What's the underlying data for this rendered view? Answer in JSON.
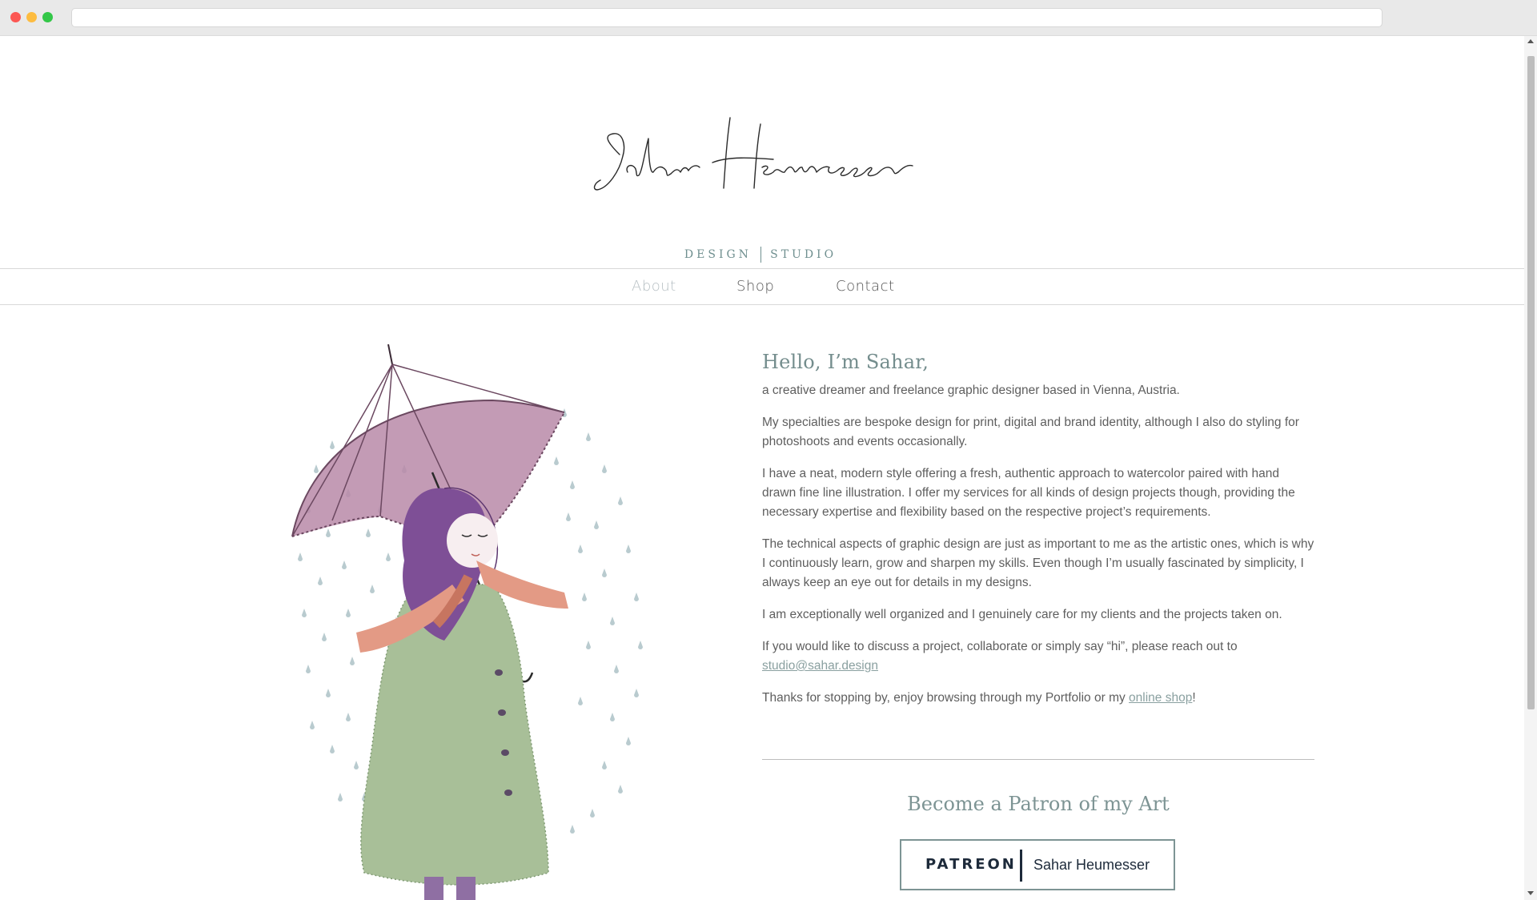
{
  "browser": {
    "url": ""
  },
  "logo": {
    "script_name": "Sahar Heumesser",
    "subtitle_left": "DESIGN",
    "subtitle_right": "STUDIO"
  },
  "nav": {
    "items": [
      {
        "label": "About",
        "active": true
      },
      {
        "label": "Shop",
        "active": false
      },
      {
        "label": "Contact",
        "active": false
      }
    ]
  },
  "about": {
    "greeting": "Hello, I’m Sahar,",
    "intro": "a creative dreamer and freelance graphic designer based in Vienna, Austria.",
    "p1": "My specialties are bespoke design for print, digital and brand identity, although I also do styling for photoshoots and events occasionally.",
    "p2": "I have a neat, modern style offering a fresh, authentic approach to watercolor paired with hand drawn fine line illustration. I offer my services for all kinds of design projects though, providing the necessary expertise and flexibility based on the respective project’s requirements.",
    "p3": "The technical aspects of graphic design are just as important to me as the artistic ones, which is why I continuously learn, grow and sharpen my skills. Even though I’m usually fascinated by simplicity, I always keep an eye out for details in my designs.",
    "p4": "I am exceptionally well organized and I genuinely care for my clients and the projects taken on.",
    "p5_text": "If you would like to discuss a project, collaborate or simply say “hi”, please reach out to",
    "email": "studio@sahar.design",
    "p6_text": "Thanks for stopping by, enjoy browsing through my Portfolio or my",
    "shop_link": "online shop",
    "p6_end": "!"
  },
  "patron": {
    "title": "Become a Patron of my Art",
    "brand": "PATREON",
    "name": "Sahar Heumesser"
  },
  "colors": {
    "accent": "#748d8d",
    "text": "#5e5e5e",
    "nav_active": "#b5bec2",
    "umbrella": "#b98aa8",
    "coat": "#a8bf98",
    "hair": "#7e4f96",
    "scarf": "#e39a85",
    "rain": "#b7c9cc"
  }
}
